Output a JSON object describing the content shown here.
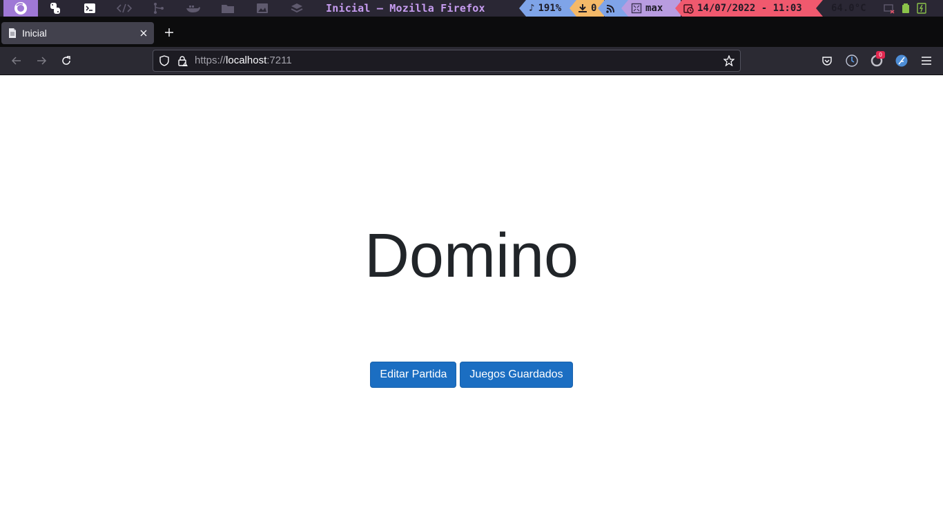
{
  "system_bar": {
    "window_title": "Inicial — Mozilla Firefox",
    "workspaces": [
      "firefox-icon",
      "python-icon",
      "terminal-icon",
      "code-icon",
      "git-icon",
      "docker-icon",
      "folder-icon",
      "image-icon",
      "layers-icon"
    ],
    "volume": "191%",
    "downloads": "0",
    "layout_mode": "max",
    "datetime": "14/07/2022 - 11:03",
    "temperature": "64.0°C",
    "colors": {
      "accent": "#9f78d6",
      "volume": "#7fa4e8",
      "downloads": "#f4b968",
      "date": "#f0596e"
    }
  },
  "browser": {
    "tab": {
      "title": "Inicial",
      "close_label": "×"
    },
    "new_tab_label": "+",
    "url": {
      "scheme": "https://",
      "host": "localhost",
      "port": ":7211"
    },
    "notification_count": "0"
  },
  "page": {
    "title": "Domino",
    "buttons": {
      "edit": "Editar Partida",
      "saved": "Juegos Guardados"
    },
    "colors": {
      "primary": "#1b6ec2",
      "title_text": "#212529"
    }
  }
}
